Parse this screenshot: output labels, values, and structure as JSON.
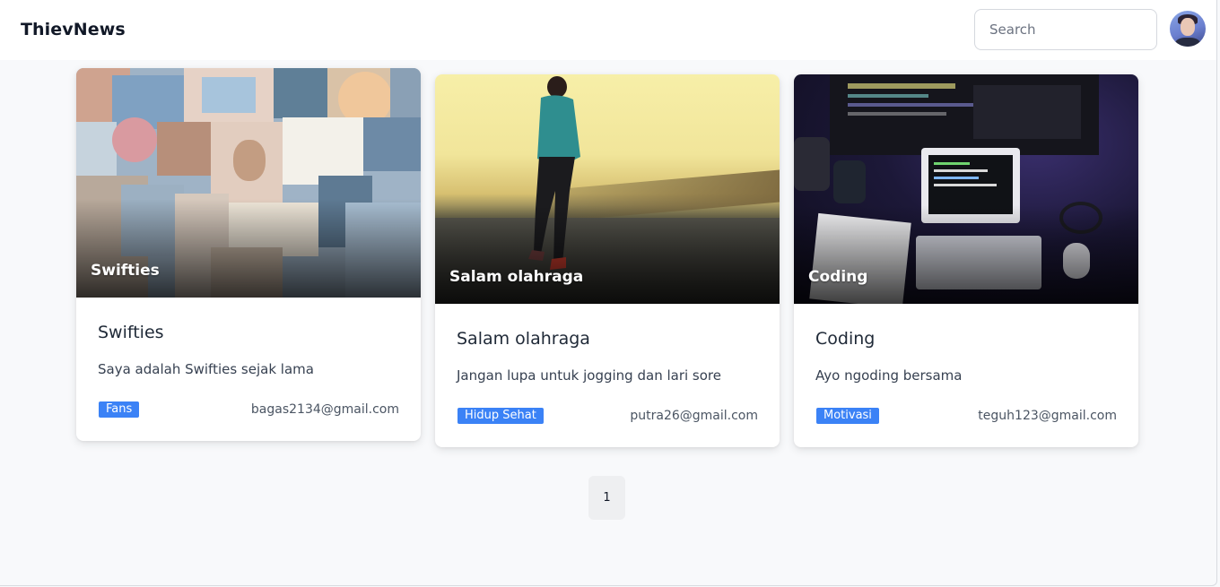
{
  "navbar": {
    "brand": "ThievNews",
    "search_placeholder": "Search"
  },
  "cards": [
    {
      "overlay_title": "Swifties",
      "title": "Swifties",
      "description": "Saya adalah Swifties sejak lama",
      "tag": "Fans",
      "author_email": "bagas2134@gmail.com"
    },
    {
      "overlay_title": "Salam olahraga",
      "title": "Salam olahraga",
      "description": "Jangan lupa untuk jogging dan lari sore",
      "tag": "Hidup Sehat",
      "author_email": "putra26@gmail.com"
    },
    {
      "overlay_title": "Coding",
      "title": "Coding",
      "description": "Ayo ngoding bersama",
      "tag": "Motivasi",
      "author_email": "teguh123@gmail.com"
    }
  ],
  "pagination": {
    "current_page": "1"
  },
  "colors": {
    "tag_background": "#3b82f6",
    "page_background": "#f8f9fb"
  }
}
